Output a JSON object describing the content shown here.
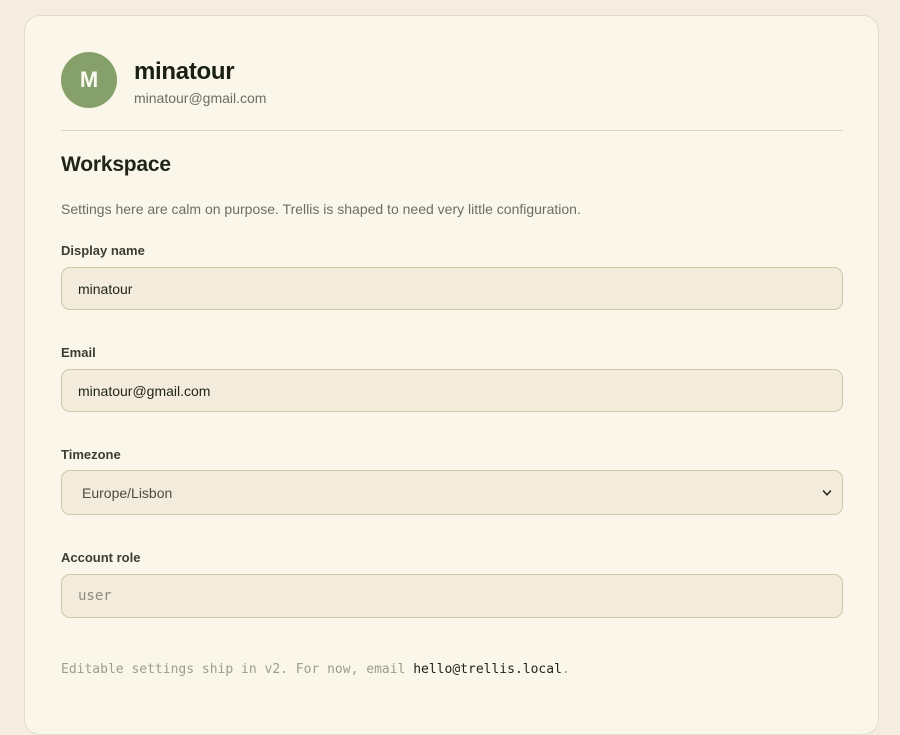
{
  "profile": {
    "avatar_initial": "M",
    "name": "minatour",
    "email": "minatour@gmail.com"
  },
  "workspace": {
    "title": "Workspace",
    "description": "Settings here are calm on purpose. Trellis is shaped to need very little configuration."
  },
  "fields": {
    "display_name": {
      "label": "Display name",
      "value": "minatour"
    },
    "email": {
      "label": "Email",
      "value": "minatour@gmail.com"
    },
    "timezone": {
      "label": "Timezone",
      "value": "Europe/Lisbon"
    },
    "account_role": {
      "label": "Account role",
      "value": "user"
    }
  },
  "footnote": {
    "text": "Editable settings ship in v2. For now, email ",
    "link": "hello@trellis.local",
    "suffix": "."
  },
  "icons": {
    "timezone_dropdown": "chevron-down-icon"
  }
}
